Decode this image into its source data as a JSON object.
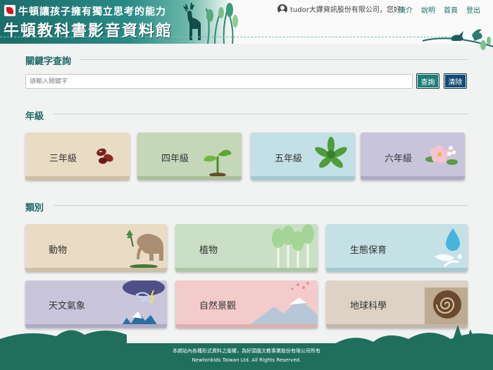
{
  "header": {
    "slogan": "牛頓讓孩子擁有獨立思考的能力",
    "site_title": "牛頓教科書影音資料館",
    "greeting": "tudor大鐸資訊股份有限公司，您好！",
    "nav": [
      "簡介",
      "說明",
      "首頁",
      "登出"
    ]
  },
  "search": {
    "title": "關鍵字查詢",
    "placeholder": "請輸入關鍵字",
    "value": "",
    "search_label": "查詢",
    "clear_label": "清除"
  },
  "grades": {
    "title": "年級",
    "items": [
      {
        "label": "三年級",
        "bg": "#e9dcc4",
        "bar": "#cfc0a3"
      },
      {
        "label": "四年級",
        "bg": "#c4d7b9",
        "bar": "#a7c19b"
      },
      {
        "label": "五年級",
        "bg": "#c3e0e6",
        "bar": "#a2cad2"
      },
      {
        "label": "六年級",
        "bg": "#c8c4da",
        "bar": "#aeaac6"
      }
    ]
  },
  "categories": {
    "title": "類別",
    "items": [
      {
        "label": "動物",
        "bg": "#eadcc4",
        "bar": "#cfc0a3"
      },
      {
        "label": "植物",
        "bg": "#cadfc5",
        "bar": "#a9c8a3"
      },
      {
        "label": "生態保育",
        "bg": "#c4e1e6",
        "bar": "#a4cbd2"
      },
      {
        "label": "天文氣象",
        "bg": "#c9c6dc",
        "bar": "#aeaac6"
      },
      {
        "label": "自然景觀",
        "bg": "#f3cbcb",
        "bar": "#ddb0b0"
      },
      {
        "label": "地球科學",
        "bg": "#ddd2c4",
        "bar": "#c3b6a6"
      }
    ]
  },
  "footer": {
    "line1": "本網站內各種形式資料之版權，為好頭腦文教事業股份有限公司所有",
    "line2": "Newtonkids Taiwan Ltd. All Rights Reserved."
  }
}
